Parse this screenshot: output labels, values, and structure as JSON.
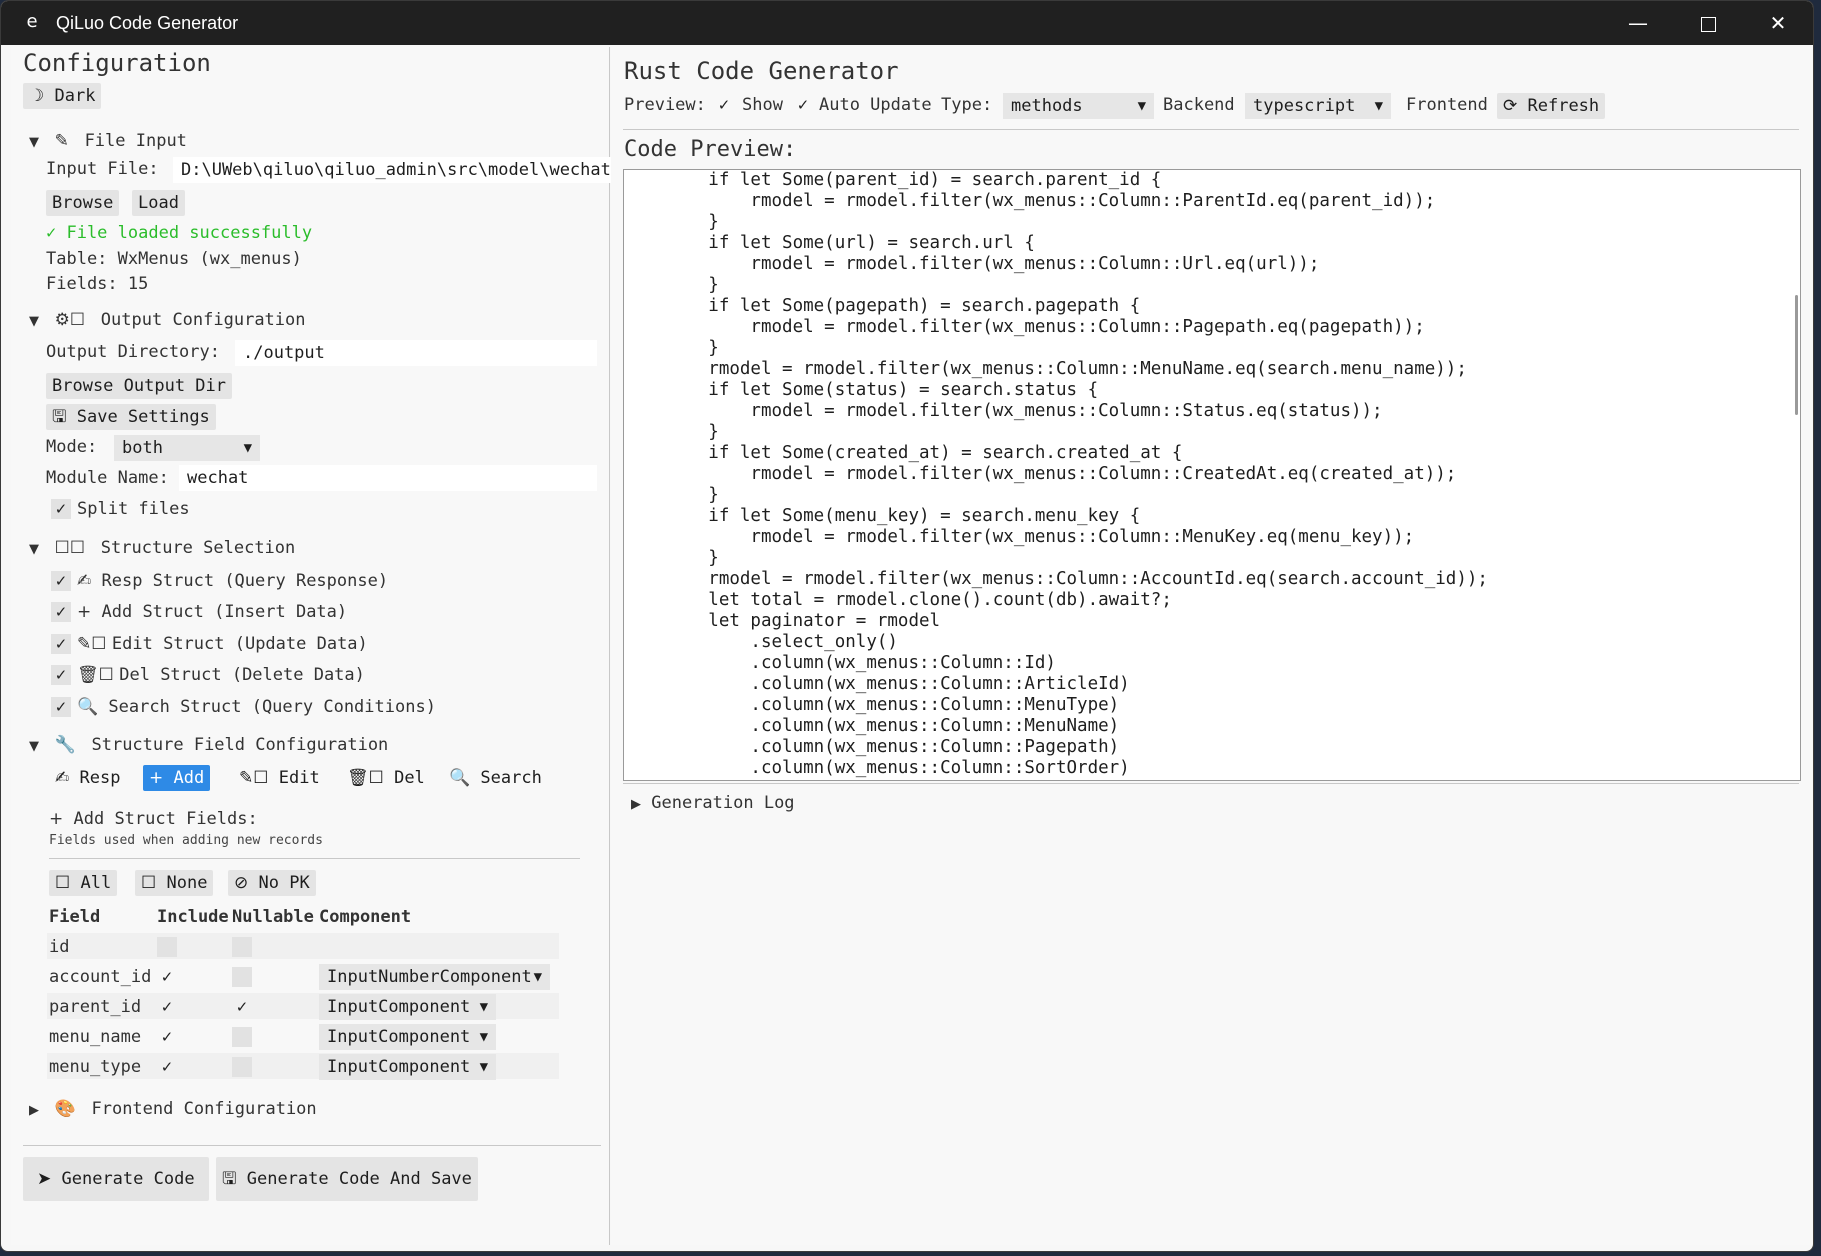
{
  "window": {
    "title": "QiLuo Code Generator",
    "app_icon": "e",
    "buttons": [
      "minimize",
      "maximize",
      "close"
    ]
  },
  "left": {
    "heading": "Configuration",
    "theme_button": "Dark",
    "file_input": {
      "section": "File Input",
      "input_label": "Input File:",
      "input_value": "D:\\UWeb\\qiluo\\qiluo_admin\\src\\model\\wechat\\",
      "browse": "Browse",
      "load": "Load",
      "status": "✓ File loaded successfully",
      "table": "Table: WxMenus (wx_menus)",
      "fields": "Fields: 15"
    },
    "output": {
      "section": "Output Configuration",
      "dir_label": "Output Directory:",
      "dir_value": "./output",
      "browse_dir": "Browse Output Dir",
      "save_settings": "Save Settings",
      "mode_label": "Mode:",
      "mode_value": "both",
      "module_label": "Module Name:",
      "module_value": "wechat",
      "split_files": "Split files"
    },
    "structure": {
      "section": "Structure Selection",
      "items": [
        {
          "label": "Resp Struct (Query Response)",
          "icon": "✍"
        },
        {
          "label": "Add Struct (Insert Data)",
          "icon": "+"
        },
        {
          "label": "Edit Struct (Update Data)",
          "icon": "✎"
        },
        {
          "label": "Del Struct (Delete Data)",
          "icon": "🗑"
        },
        {
          "label": "Search Struct (Query Conditions)",
          "icon": "🔍"
        }
      ]
    },
    "field_config": {
      "section": "Structure Field Configuration",
      "tabs": [
        "Resp",
        "Add",
        "Edit",
        "Del",
        "Search"
      ],
      "active_tab": "Add",
      "title": "Add Struct Fields:",
      "desc": "Fields used when adding new records",
      "all": "All",
      "none": "None",
      "no_pk": "No PK",
      "headers": [
        "Field",
        "Include",
        "Nullable",
        "Component"
      ],
      "rows": [
        {
          "field": "id",
          "include": false,
          "nullable": false,
          "component": ""
        },
        {
          "field": "account_id",
          "include": true,
          "nullable": false,
          "component": "InputNumberComponent"
        },
        {
          "field": "parent_id",
          "include": true,
          "nullable": true,
          "component": "InputComponent"
        },
        {
          "field": "menu_name",
          "include": true,
          "nullable": false,
          "component": "InputComponent"
        },
        {
          "field": "menu_type",
          "include": true,
          "nullable": false,
          "component": "InputComponent"
        }
      ]
    },
    "frontend_section": "Frontend Configuration",
    "generate_code": "Generate Code",
    "generate_save": "Generate Code And Save"
  },
  "right": {
    "heading": "Rust Code Generator",
    "preview_label": "Preview:",
    "show": "Show",
    "auto_update": "Auto Update",
    "type_label": "Type:",
    "type_value": "methods",
    "backend_label": "Backend",
    "backend_value": "typescript",
    "frontend_label": "Frontend",
    "refresh": "Refresh",
    "code_preview_title": "Code Preview:",
    "code_lines": [
      "        if let Some(parent_id) = search.parent_id {",
      "            rmodel = rmodel.filter(wx_menus::Column::ParentId.eq(parent_id));",
      "        }",
      "        if let Some(url) = search.url {",
      "            rmodel = rmodel.filter(wx_menus::Column::Url.eq(url));",
      "        }",
      "        if let Some(pagepath) = search.pagepath {",
      "            rmodel = rmodel.filter(wx_menus::Column::Pagepath.eq(pagepath));",
      "        }",
      "        rmodel = rmodel.filter(wx_menus::Column::MenuName.eq(search.menu_name));",
      "        if let Some(status) = search.status {",
      "            rmodel = rmodel.filter(wx_menus::Column::Status.eq(status));",
      "        }",
      "        if let Some(created_at) = search.created_at {",
      "            rmodel = rmodel.filter(wx_menus::Column::CreatedAt.eq(created_at));",
      "        }",
      "        if let Some(menu_key) = search.menu_key {",
      "            rmodel = rmodel.filter(wx_menus::Column::MenuKey.eq(menu_key));",
      "        }",
      "        rmodel = rmodel.filter(wx_menus::Column::AccountId.eq(search.account_id));",
      "        let total = rmodel.clone().count(db).await?;",
      "        let paginator = rmodel",
      "            .select_only()",
      "            .column(wx_menus::Column::Id)",
      "            .column(wx_menus::Column::ArticleId)",
      "            .column(wx_menus::Column::MenuType)",
      "            .column(wx_menus::Column::MenuName)",
      "            .column(wx_menus::Column::Pagepath)",
      "            .column(wx_menus::Column::SortOrder)"
    ],
    "generation_log": "Generation Log"
  }
}
